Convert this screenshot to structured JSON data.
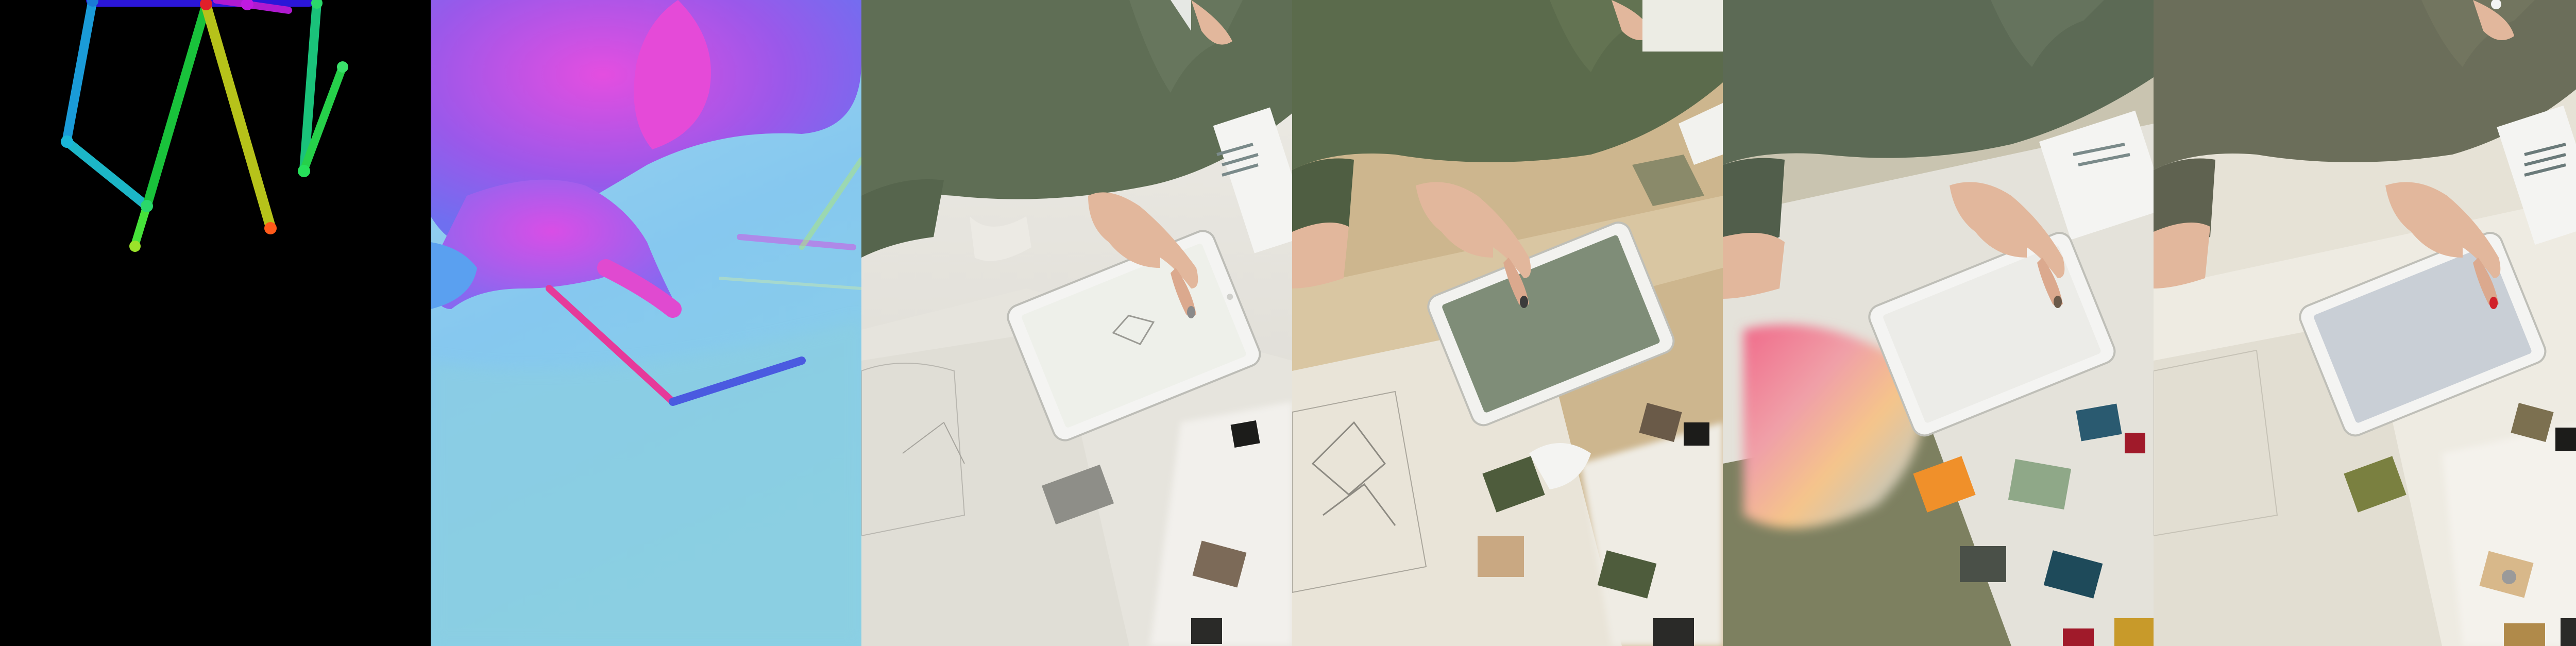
{
  "panels": [
    {
      "kind": "pose-skeleton",
      "icon": "pose-skeleton-icon"
    },
    {
      "kind": "surface-normal-map",
      "icon": "normal-map-icon"
    },
    {
      "kind": "photo",
      "tablet_screen": "#eef0ea",
      "nail": "#8a8a8a"
    },
    {
      "kind": "photo",
      "tablet_screen": "#7f8d78",
      "nail": "#3b3b3b"
    },
    {
      "kind": "photo",
      "tablet_screen": "#ecece8",
      "nail": "#6b5a4a"
    },
    {
      "kind": "photo",
      "tablet_screen": "#c9cfd6",
      "nail": "#d0202a"
    }
  ],
  "colors": {
    "background": "#000000",
    "sweater": "#5f6e55",
    "table_light": "#e8e6df",
    "table_tan": "#cdb68e",
    "skin": "#e2b79c"
  }
}
